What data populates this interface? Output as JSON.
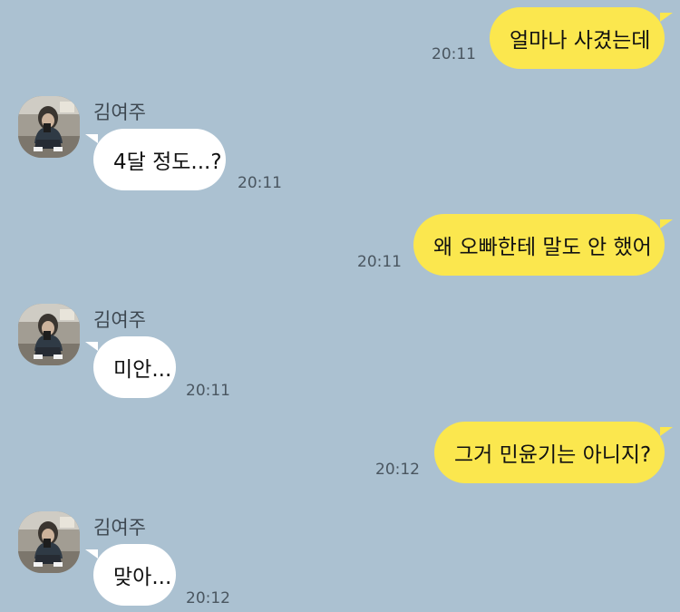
{
  "colors": {
    "chat_background": "#abc1d1",
    "my_bubble": "#fbe74e",
    "their_bubble": "#ffffff"
  },
  "messages": [
    {
      "from": "me",
      "text": "얼마나 사겼는데",
      "time": "20:11"
    },
    {
      "from": "them",
      "sender": "김여주",
      "avatar": "profile-photo",
      "text": "4달 정도...?",
      "time": "20:11"
    },
    {
      "from": "me",
      "text": "왜 오빠한테 말도 안 했어",
      "time": "20:11"
    },
    {
      "from": "them",
      "sender": "김여주",
      "avatar": "profile-photo",
      "text": "미안...",
      "time": "20:11"
    },
    {
      "from": "me",
      "text": "그거 민윤기는 아니지?",
      "time": "20:12"
    },
    {
      "from": "them",
      "sender": "김여주",
      "avatar": "profile-photo",
      "text": "맞아...",
      "time": "20:12"
    }
  ]
}
